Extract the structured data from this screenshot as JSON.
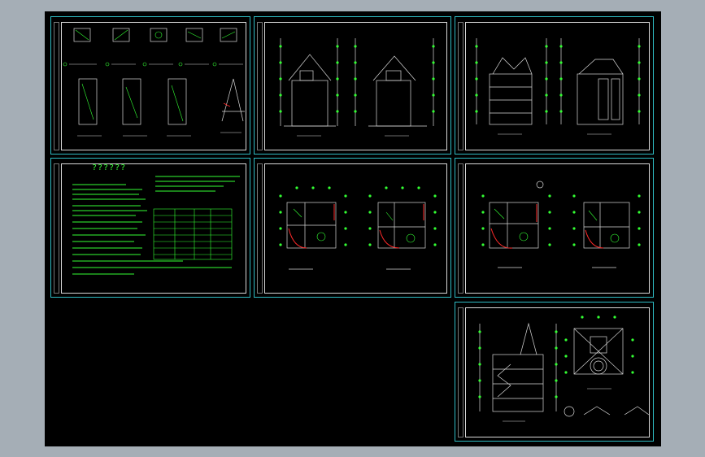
{
  "drawing": {
    "background": "#000000",
    "frame_color": "#2fbcc4",
    "line_color": "#d8d8d8",
    "accent_green": "#33ff33",
    "accent_red": "#ff2a2a"
  },
  "sheets": [
    {
      "id": "details",
      "title_a": "",
      "title_b": ""
    },
    {
      "id": "elevations-1",
      "title_a": "",
      "title_b": ""
    },
    {
      "id": "elevations-2",
      "title_a": "",
      "title_b": ""
    },
    {
      "id": "notes",
      "notes_title": "??????"
    },
    {
      "id": "plans-1",
      "title_a": "",
      "title_b": ""
    },
    {
      "id": "plans-2",
      "title_a": "",
      "title_b": ""
    },
    {
      "id": "section-roof",
      "title_a": "",
      "title_b": ""
    }
  ]
}
